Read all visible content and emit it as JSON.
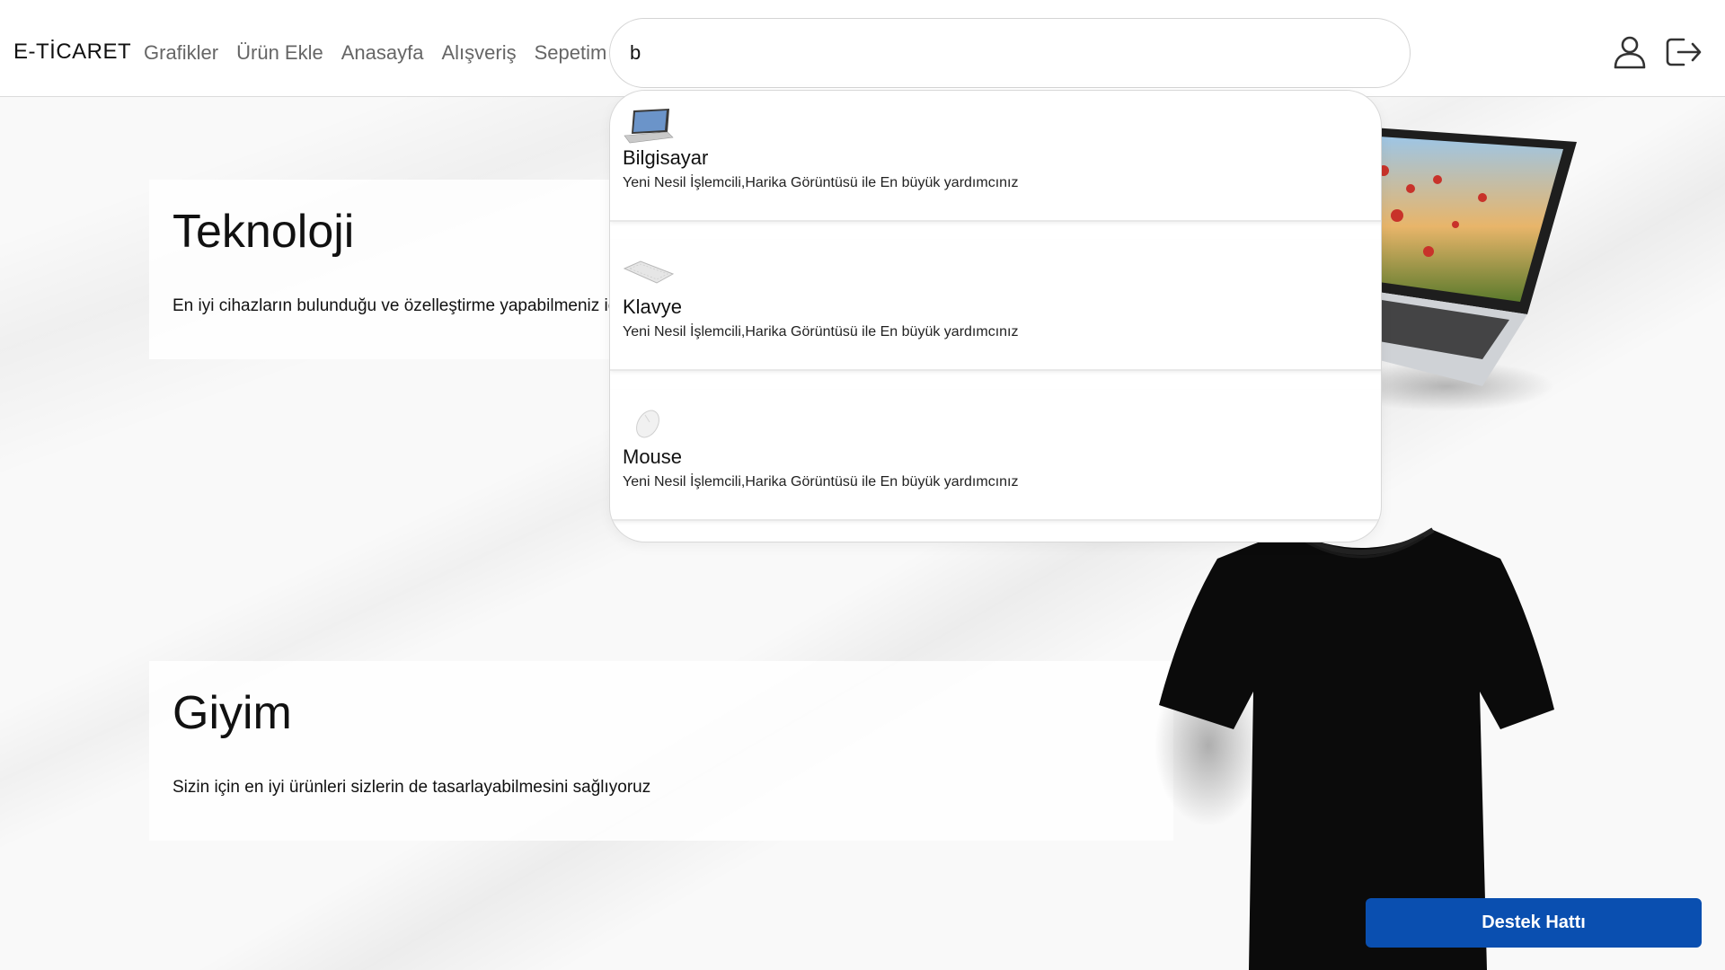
{
  "navbar": {
    "brand": "E-TİCARET",
    "links": [
      "Grafikler",
      "Ürün Ekle",
      "Anasayfa",
      "Alışveriş",
      "Sepetim"
    ],
    "search": {
      "value": "b",
      "placeholder": ""
    },
    "icons": [
      "user-icon",
      "logout-icon"
    ]
  },
  "dropdown": {
    "items": [
      {
        "name": "Bilgisayar",
        "desc": "Yeni Nesil İşlemcili,Harika Görüntüsü ile En büyük yardımcınız",
        "icon": "laptop-thumbnail"
      },
      {
        "name": "Klavye",
        "desc": "Yeni Nesil İşlemcili,Harika Görüntüsü ile En büyük yardımcınız",
        "icon": "keyboard-thumbnail"
      },
      {
        "name": "Mouse",
        "desc": "Yeni Nesil İşlemcili,Harika Görüntüsü ile En büyük yardımcınız",
        "icon": "mouse-thumbnail"
      }
    ]
  },
  "sections": [
    {
      "title": "Teknoloji",
      "text": "En iyi cihazların bulunduğu ve özelleştirme yapabilmeniz için"
    },
    {
      "title": "Giyim",
      "text": "Sizin için en iyi ürünleri sizlerin de tasarlayabilmesini sağlıyoruz"
    }
  ],
  "support": {
    "label": "Destek Hattı"
  },
  "colors": {
    "support_button": "#0a4fb0",
    "nav_link": "#666666",
    "brand": "#111111"
  }
}
